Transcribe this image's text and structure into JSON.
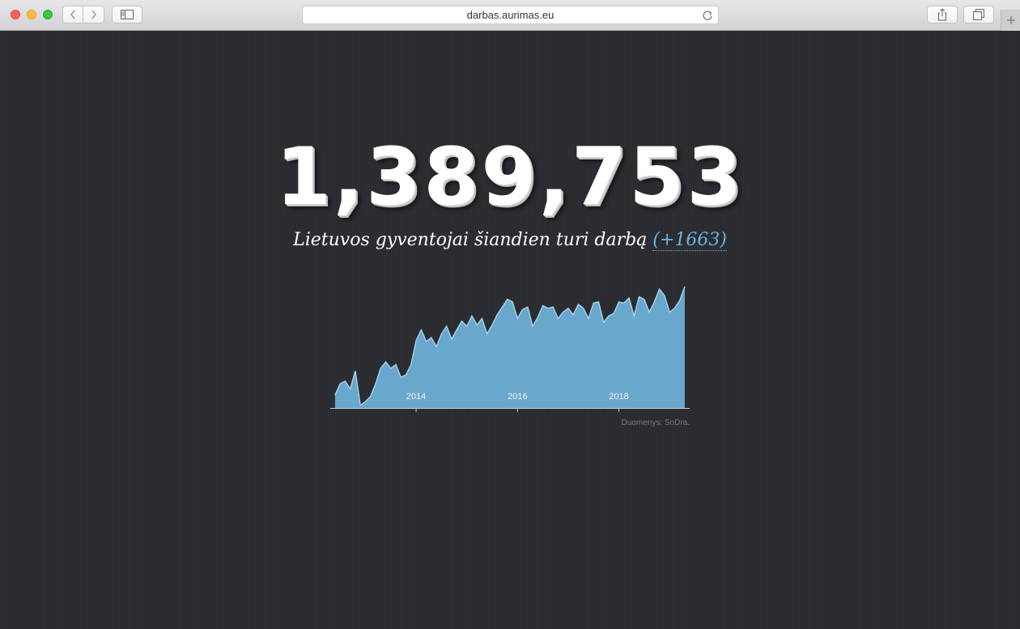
{
  "browser": {
    "url": "darbas.aurimas.eu"
  },
  "page": {
    "headline_number": "1,389,753",
    "subtitle": "Lietuvos gyventojai šiandien turi darbą",
    "daily_change": "(+1663)",
    "source_note": "Duomenys: SoDra."
  },
  "colors": {
    "background": "#2a2b2f",
    "area_fill": "#6aa7cd",
    "area_stroke": "#a6d4ee",
    "accent": "#6ab4e4"
  },
  "chart_data": {
    "type": "area",
    "x_tick_labels": [
      "2014",
      "2016",
      "2018"
    ],
    "xlim": [
      2012.37,
      2019.35
    ],
    "ylim": [
      0,
      1
    ],
    "y_units": "relative (no y-axis printed)",
    "grid": false,
    "legend": "none",
    "x": [
      2012.4,
      2012.5,
      2012.6,
      2012.7,
      2012.8,
      2012.9,
      2013.0,
      2013.1,
      2013.2,
      2013.3,
      2013.4,
      2013.5,
      2013.6,
      2013.7,
      2013.8,
      2013.9,
      2014.0,
      2014.1,
      2014.2,
      2014.3,
      2014.4,
      2014.5,
      2014.6,
      2014.7,
      2014.8,
      2014.9,
      2015.0,
      2015.1,
      2015.2,
      2015.3,
      2015.4,
      2015.5,
      2015.6,
      2015.7,
      2015.8,
      2015.9,
      2016.0,
      2016.1,
      2016.2,
      2016.3,
      2016.4,
      2016.5,
      2016.6,
      2016.7,
      2016.8,
      2016.9,
      2017.0,
      2017.1,
      2017.2,
      2017.3,
      2017.4,
      2017.5,
      2017.6,
      2017.7,
      2017.8,
      2017.9,
      2018.0,
      2018.1,
      2018.2,
      2018.3,
      2018.4,
      2018.5,
      2018.6,
      2018.7,
      2018.8,
      2018.9,
      2019.0,
      2019.1,
      2019.2,
      2019.3
    ],
    "values": [
      0.1,
      0.19,
      0.21,
      0.15,
      0.29,
      0.02,
      0.05,
      0.09,
      0.19,
      0.31,
      0.36,
      0.31,
      0.34,
      0.24,
      0.26,
      0.34,
      0.53,
      0.61,
      0.52,
      0.55,
      0.48,
      0.58,
      0.64,
      0.54,
      0.61,
      0.68,
      0.64,
      0.72,
      0.65,
      0.7,
      0.58,
      0.65,
      0.73,
      0.79,
      0.85,
      0.83,
      0.7,
      0.77,
      0.79,
      0.64,
      0.71,
      0.8,
      0.78,
      0.79,
      0.7,
      0.75,
      0.78,
      0.73,
      0.81,
      0.78,
      0.7,
      0.82,
      0.83,
      0.67,
      0.72,
      0.74,
      0.83,
      0.82,
      0.86,
      0.72,
      0.87,
      0.85,
      0.75,
      0.83,
      0.93,
      0.88,
      0.75,
      0.78,
      0.84,
      0.95
    ]
  }
}
